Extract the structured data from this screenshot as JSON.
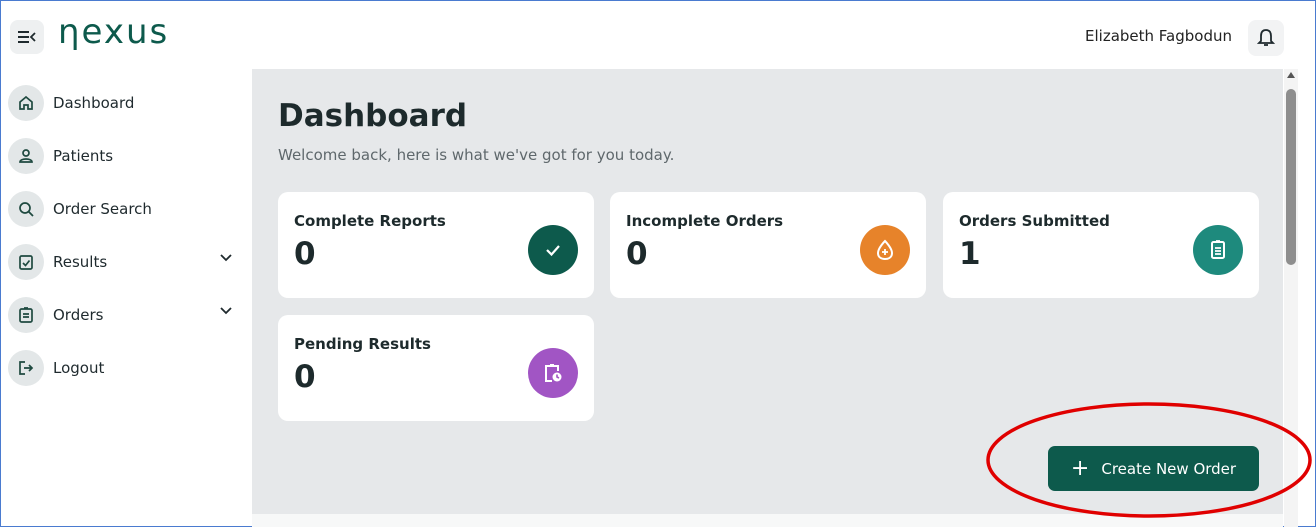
{
  "header": {
    "logo": "ηexus",
    "user_name": "Elizabeth Fagbodun"
  },
  "sidebar": {
    "items": [
      {
        "label": "Dashboard",
        "icon": "home-icon"
      },
      {
        "label": "Patients",
        "icon": "user-icon"
      },
      {
        "label": "Order Search",
        "icon": "search-icon"
      },
      {
        "label": "Results",
        "icon": "clipboard-check-icon",
        "expandable": true
      },
      {
        "label": "Orders",
        "icon": "clipboard-list-icon",
        "expandable": true
      },
      {
        "label": "Logout",
        "icon": "logout-icon"
      }
    ]
  },
  "main": {
    "title": "Dashboard",
    "subtitle": "Welcome back, here is what we've got for you today.",
    "cards": [
      {
        "title": "Complete Reports",
        "value": "0",
        "icon": "check-icon",
        "color": "#0d5a4c"
      },
      {
        "title": "Incomplete Orders",
        "value": "0",
        "icon": "drop-icon",
        "color": "#e7832a"
      },
      {
        "title": "Orders Submitted",
        "value": "1",
        "icon": "clipboard-icon",
        "color": "#1e8a7d"
      },
      {
        "title": "Pending Results",
        "value": "0",
        "icon": "clipboard-clock-icon",
        "color": "#a155c4"
      }
    ],
    "create_button": {
      "plus": "+",
      "label": "Create New Order"
    }
  },
  "colors": {
    "brand": "#0d5a4c",
    "annotation": "#e00000"
  }
}
